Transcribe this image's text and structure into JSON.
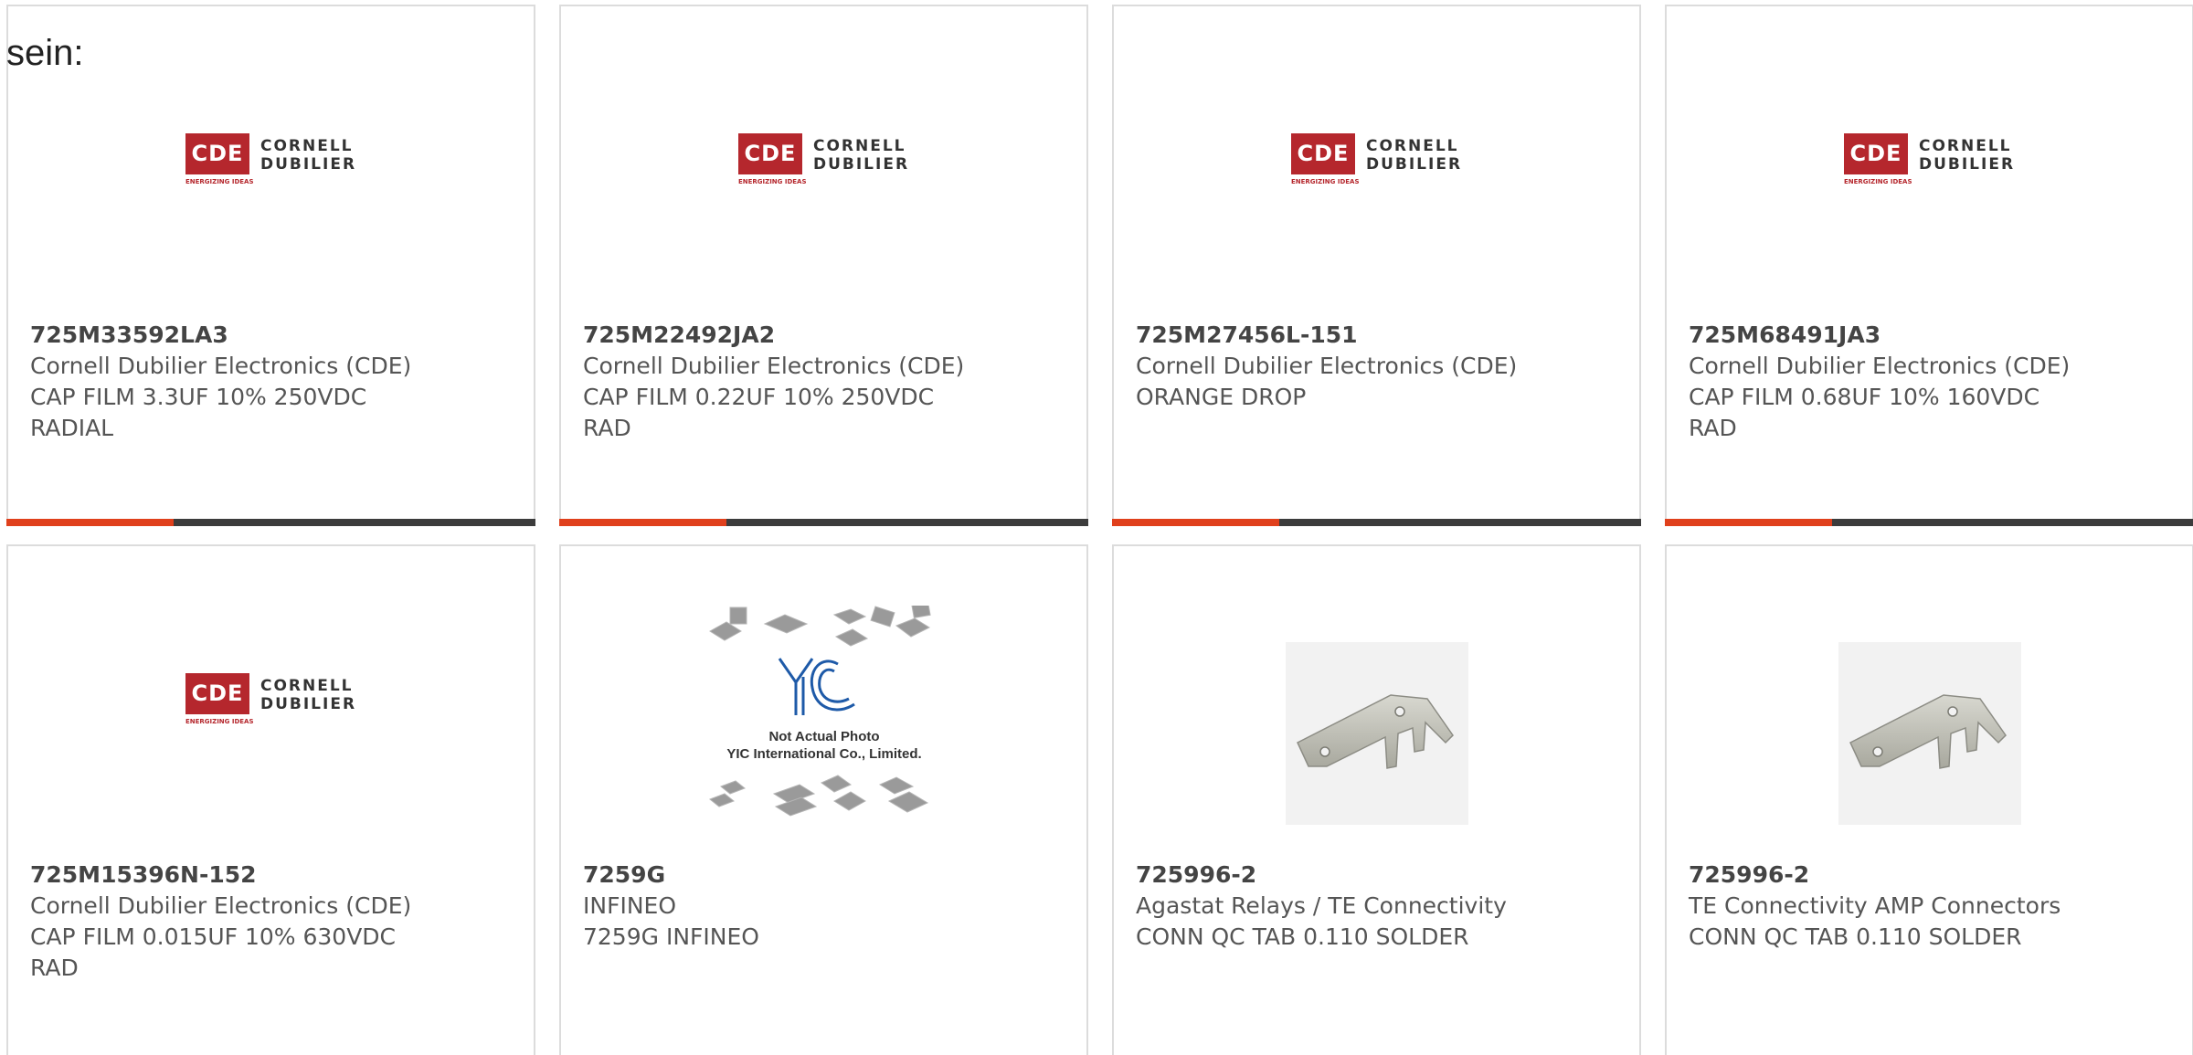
{
  "header_fragment": "sein:",
  "brand": {
    "accent": "#e0401c",
    "bar": "#3c3c3c",
    "border": "#dcdcdc"
  },
  "cde_logo": {
    "mark": "CDE",
    "line1": "CORNELL",
    "line2": "DUBILIER",
    "tagline": "ENERGIZING IDEAS"
  },
  "yic_image": {
    "mark": "YIC",
    "line1": "Not Actual Photo",
    "line2": "YIC International Co., Limited."
  },
  "products": [
    {
      "mpn": "725M33592LA3",
      "manufacturer": "Cornell Dubilier Electronics (CDE)",
      "description": "CAP FILM 3.3UF 10% 250VDC RADIAL",
      "image": "cde-logo",
      "status_bar": true
    },
    {
      "mpn": "725M22492JA2",
      "manufacturer": "Cornell Dubilier Electronics (CDE)",
      "description": "CAP FILM 0.22UF 10% 250VDC RAD",
      "image": "cde-logo",
      "status_bar": true
    },
    {
      "mpn": "725M27456L-151",
      "manufacturer": "Cornell Dubilier Electronics (CDE)",
      "description": "ORANGE DROP",
      "image": "cde-logo",
      "status_bar": true
    },
    {
      "mpn": "725M68491JA3",
      "manufacturer": "Cornell Dubilier Electronics (CDE)",
      "description": "CAP FILM 0.68UF 10% 160VDC RAD",
      "image": "cde-logo",
      "status_bar": true
    },
    {
      "mpn": "725M15396N-152",
      "manufacturer": "Cornell Dubilier Electronics (CDE)",
      "description": "CAP FILM 0.015UF 10% 630VDC RAD",
      "image": "cde-logo",
      "status_bar": false
    },
    {
      "mpn": "7259G",
      "manufacturer": "INFINEO",
      "description": "7259G INFINEO",
      "image": "yic-placeholder",
      "status_bar": false
    },
    {
      "mpn": "725996-2",
      "manufacturer": "Agastat Relays / TE Connectivity",
      "description": "CONN QC TAB 0.110 SOLDER",
      "image": "qc-tab-terminal",
      "status_bar": false
    },
    {
      "mpn": "725996-2",
      "manufacturer": "TE Connectivity AMP Connectors",
      "description": "CONN QC TAB 0.110 SOLDER",
      "image": "qc-tab-terminal",
      "status_bar": false
    }
  ]
}
